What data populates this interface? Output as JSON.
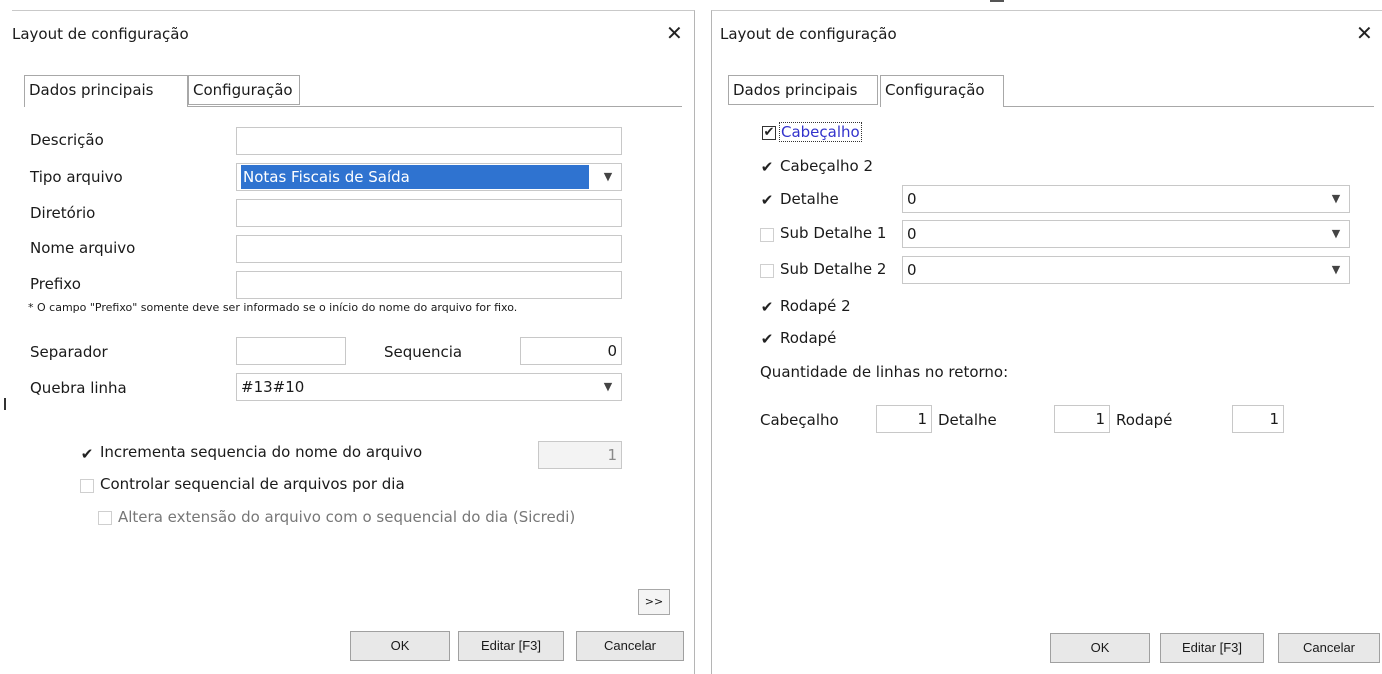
{
  "left": {
    "title": "Layout de configuração",
    "close_icon": "close-icon",
    "tabs": [
      {
        "label": "Dados principais"
      },
      {
        "label": "Configuração"
      }
    ],
    "fields": {
      "descricao_label": "Descrição",
      "descricao_value": "",
      "tipo_label": "Tipo arquivo",
      "tipo_value": "Notas Fiscais de Saída",
      "diretorio_label": "Diretório",
      "diretorio_value": "",
      "nome_label": "Nome arquivo",
      "nome_value": "",
      "prefixo_label": "Prefixo",
      "prefixo_value": "",
      "prefixo_note": "* O campo \"Prefixo\" somente deve ser informado se o início do nome do arquivo for fixo.",
      "separador_label": "Separador",
      "separador_value": "",
      "sequencia_label": "Sequencia",
      "sequencia_value": "0",
      "quebra_label": "Quebra linha",
      "quebra_value": "#13#10"
    },
    "options": {
      "incrementa_label": "Incrementa sequencia do nome do arquivo",
      "incrementa_checked": true,
      "incrementa_value": "1",
      "controlar_label": "Controlar sequencial de arquivos por dia",
      "controlar_checked": false,
      "altera_label": "Altera extensão do arquivo com o sequencial do dia (Sicredi)",
      "altera_checked": false
    },
    "more_button": ">>",
    "buttons": {
      "ok": "OK",
      "editar": "Editar [F3]",
      "cancelar": "Cancelar"
    }
  },
  "right": {
    "title": "Layout de configuração",
    "close_icon": "close-icon",
    "tabs": [
      {
        "label": "Dados principais"
      },
      {
        "label": "Configuração"
      }
    ],
    "sections": {
      "cabecalho": {
        "label": "Cabeçalho",
        "checked": true
      },
      "cabecalho2": {
        "label": "Cabeçalho 2",
        "checked": true
      },
      "detalhe": {
        "label": "Detalhe",
        "checked": true,
        "value": "0"
      },
      "subdetalhe1": {
        "label": "Sub Detalhe 1",
        "checked": false,
        "value": "0"
      },
      "subdetalhe2": {
        "label": "Sub Detalhe 2",
        "checked": false,
        "value": "0"
      },
      "rodape2": {
        "label": "Rodapé 2",
        "checked": true
      },
      "rodape": {
        "label": "Rodapé",
        "checked": true
      }
    },
    "qtd_label": "Quantidade de linhas no retorno:",
    "qtd": {
      "cabecalho_label": "Cabeçalho",
      "cabecalho_value": "1",
      "detalhe_label": "Detalhe",
      "detalhe_value": "1",
      "rodape_label": "Rodapé",
      "rodape_value": "1"
    },
    "buttons": {
      "ok": "OK",
      "editar": "Editar [F3]",
      "cancelar": "Cancelar"
    }
  }
}
